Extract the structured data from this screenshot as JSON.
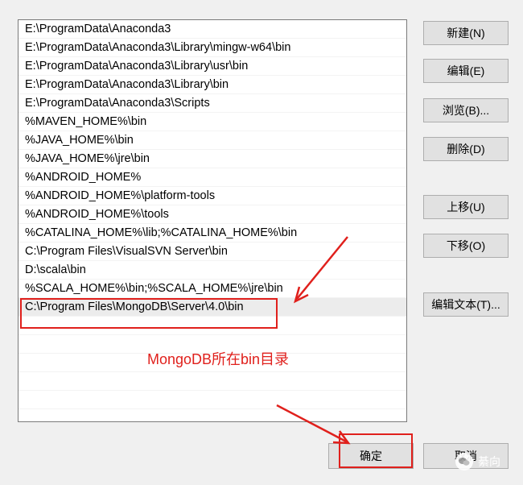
{
  "path_list": {
    "items": [
      "E:\\ProgramData\\Anaconda3",
      "E:\\ProgramData\\Anaconda3\\Library\\mingw-w64\\bin",
      "E:\\ProgramData\\Anaconda3\\Library\\usr\\bin",
      "E:\\ProgramData\\Anaconda3\\Library\\bin",
      "E:\\ProgramData\\Anaconda3\\Scripts",
      "%MAVEN_HOME%\\bin",
      "%JAVA_HOME%\\bin",
      "%JAVA_HOME%\\jre\\bin",
      "%ANDROID_HOME%",
      "%ANDROID_HOME%\\platform-tools",
      "%ANDROID_HOME%\\tools",
      "%CATALINA_HOME%\\lib;%CATALINA_HOME%\\bin",
      "C:\\Program Files\\VisualSVN Server\\bin",
      "D:\\scala\\bin",
      "%SCALA_HOME%\\bin;%SCALA_HOME%\\jre\\bin",
      "C:\\Program Files\\MongoDB\\Server\\4.0\\bin"
    ],
    "selected_index": 15
  },
  "buttons": {
    "new": "新建(N)",
    "edit": "编辑(E)",
    "browse": "浏览(B)...",
    "delete": "删除(D)",
    "move_up": "上移(U)",
    "move_down": "下移(O)",
    "edit_text": "编辑文本(T)...",
    "ok": "确定",
    "cancel": "取消"
  },
  "annotation": {
    "text": "MongoDB所在bin目录",
    "color": "#e0201c"
  },
  "watermark": {
    "text": "綦向"
  }
}
